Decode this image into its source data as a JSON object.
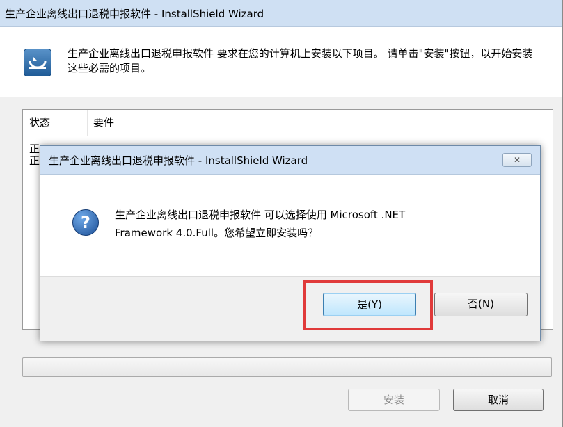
{
  "outer_window": {
    "title": "生产企业离线出口退税申报软件 - InstallShield Wizard",
    "intro_text": "生产企业离线出口退税申报软件 要求在您的计算机上安装以下项目。 请单击\"安装\"按钮，以开始安装这些必需的项目。",
    "icon": "setup-icon",
    "table": {
      "columns": [
        "状态",
        "要件"
      ],
      "rows": [
        {
          "status": "正",
          "requirement": ""
        },
        {
          "status": "正",
          "requirement": ""
        }
      ]
    },
    "install_button": "安装",
    "cancel_button": "取消"
  },
  "dialog": {
    "title": "生产企业离线出口退税申报软件 - InstallShield Wizard",
    "icon": "question-icon",
    "message_line1": "生产企业离线出口退税申报软件 可以选择使用 Microsoft .NET",
    "message_line2": "Framework 4.0.Full。您希望立即安装吗？",
    "close_glyph": "✕",
    "yes_button": "是(Y)",
    "no_button": "否(N)"
  },
  "highlight_color": "#e03a3a"
}
